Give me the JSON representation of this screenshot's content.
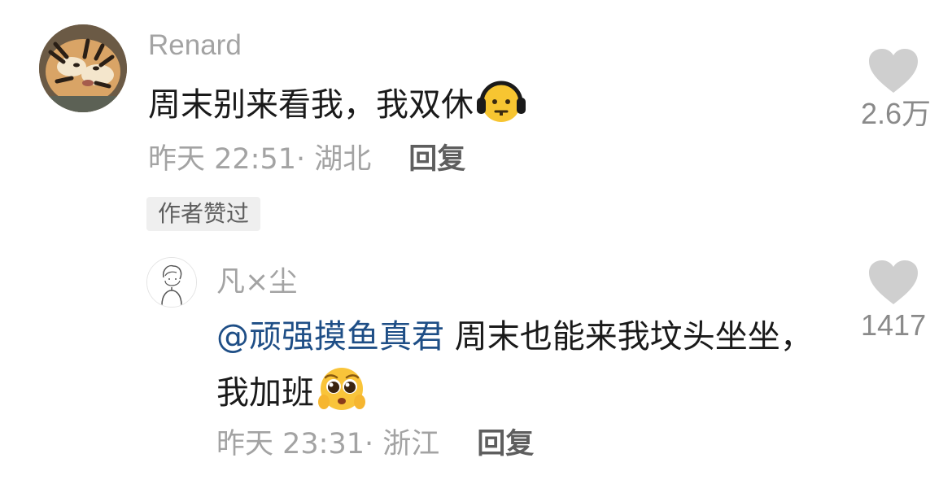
{
  "comments": [
    {
      "username": "Renard",
      "text": "周末别来看我，我双休",
      "emoji": "headphones-face-emoji",
      "time": "昨天 22:51",
      "location": "湖北",
      "reply_label": "回复",
      "badge": "作者赞过",
      "likes": "2.6万",
      "avatar": "tiger-avatar"
    }
  ],
  "reply": {
    "username": "凡×尘",
    "mention": "@顽强摸鱼真君",
    "text": " 周末也能来我坟头坐坐，我加班",
    "emoji": "pleading-face-emoji",
    "time": "昨天 23:31",
    "location": "浙江",
    "reply_label": "回复",
    "likes": "1417",
    "avatar": "sketch-avatar"
  },
  "icons": {
    "like": "heart-icon"
  },
  "colors": {
    "username": "#a3a3a3",
    "mention": "#1e4e86",
    "heart": "#cfcfcf",
    "badge_bg": "#efefef"
  }
}
